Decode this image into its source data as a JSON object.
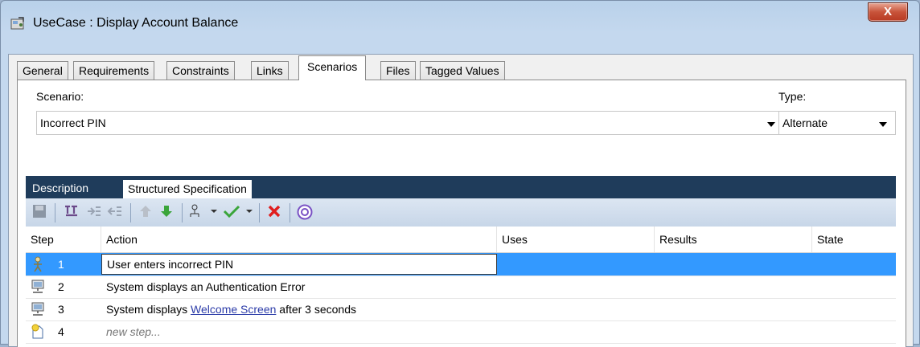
{
  "window": {
    "title": "UseCase : Display Account Balance",
    "close_label": "X"
  },
  "tabs": [
    {
      "label": "General"
    },
    {
      "label": "Requirements"
    },
    {
      "label": "Constraints"
    },
    {
      "label": "Links"
    },
    {
      "label": "Scenarios",
      "active": true
    },
    {
      "label": "Files"
    },
    {
      "label": "Tagged Values"
    }
  ],
  "scenario": {
    "label": "Scenario:",
    "value": "Incorrect PIN"
  },
  "type": {
    "label": "Type:",
    "value": "Alternate"
  },
  "subtabs": {
    "description": "Description",
    "structured": "Structured Specification"
  },
  "toolbar": {
    "icons": [
      "save-icon",
      "add-step-icon",
      "indent-icon",
      "outdent-icon",
      "move-up-icon",
      "move-down-icon",
      "generate-diagram-icon",
      "validate-icon",
      "delete-icon",
      "help-icon"
    ]
  },
  "grid": {
    "columns": {
      "step": "Step",
      "action": "Action",
      "uses": "Uses",
      "results": "Results",
      "state": "State"
    },
    "rows": [
      {
        "step": "1",
        "action": "User enters incorrect PIN",
        "actor": "user",
        "selected": true
      },
      {
        "step": "2",
        "action": "System displays an Authentication Error",
        "actor": "system"
      },
      {
        "step": "3",
        "action_prefix": "System displays ",
        "action_link": "Welcome Screen",
        "action_suffix": " after 3 seconds",
        "actor": "system"
      },
      {
        "step": "4",
        "action": "new step...",
        "actor": "new"
      }
    ]
  },
  "colors": {
    "selection": "#3399ff",
    "header_bar": "#1f3c5b",
    "link": "#2b3ba8"
  }
}
